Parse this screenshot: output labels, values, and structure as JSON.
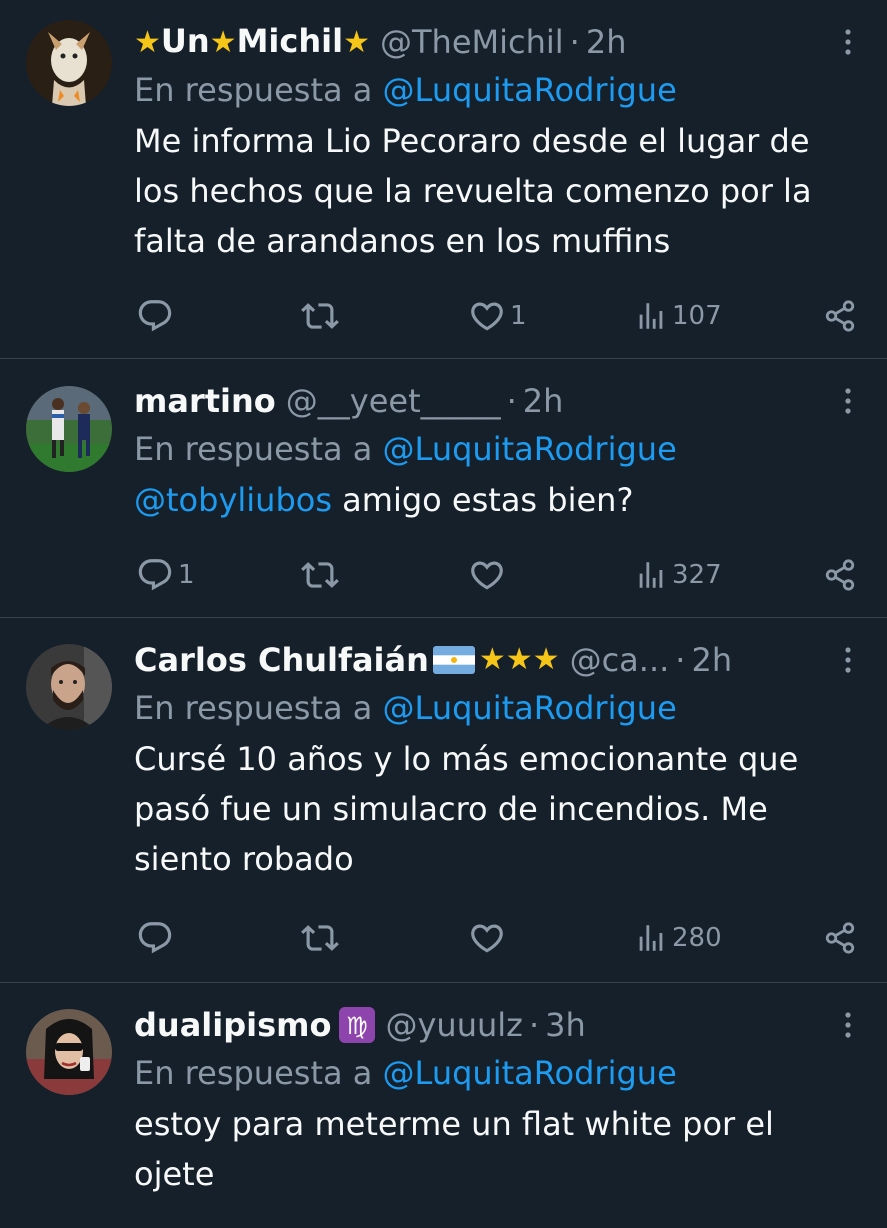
{
  "tweets": [
    {
      "name_star_left": "★",
      "name_part1": "Un",
      "name_star_mid": "★",
      "name_part2": "Michil",
      "name_star_right": "★",
      "handle": "@TheMichil",
      "time": "2h",
      "reply_prefix": "En respuesta a",
      "reply_to": "@LuquitaRodrigue",
      "text": "Me informa Lio Pecoraro desde el lugar de los hechos que la revuelta comenzo por la falta de arandanos en los muffins",
      "replies": "",
      "retweets": "",
      "likes": "1",
      "views": "107"
    },
    {
      "name": "martino",
      "handle": "@__yeet_____",
      "time": "2h",
      "reply_prefix": "En respuesta a",
      "reply_to": "@LuquitaRodrigue",
      "text_mention": "@tobyliubos",
      "text": " amigo estas bien?",
      "replies": "1",
      "retweets": "",
      "likes": "",
      "views": "327"
    },
    {
      "name": "Carlos Chulfaián",
      "name_stars": "★★★",
      "handle": "@ca...",
      "time": "2h",
      "reply_prefix": "En respuesta a",
      "reply_to": "@LuquitaRodrigue",
      "text": "Cursé 10 años y lo más emocionante que pasó fue un simulacro de incendios. Me siento robado",
      "replies": "",
      "retweets": "",
      "likes": "",
      "views": "280"
    },
    {
      "name": "dualipismo",
      "badge_glyph": "♍",
      "handle": "@yuuulz",
      "time": "3h",
      "reply_prefix": "En respuesta a",
      "reply_to": "@LuquitaRodrigue",
      "text": "estoy para meterme un flat white por el ojete"
    }
  ],
  "colors": {
    "background": "#15202b",
    "text": "#f7f9f9",
    "secondary": "#8b98a5",
    "link": "#1d9bf0",
    "divider": "#38444d",
    "star": "#f5c518"
  },
  "icons": [
    "reply-icon",
    "retweet-icon",
    "like-icon",
    "views-icon",
    "share-icon",
    "more-icon"
  ]
}
